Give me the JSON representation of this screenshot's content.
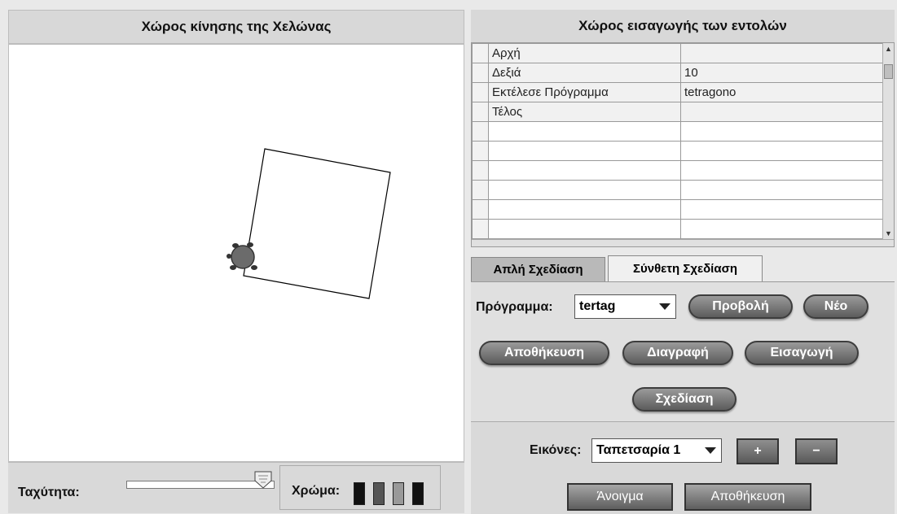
{
  "left_panel": {
    "title": "Χώρος κίνησης της Χελώνας"
  },
  "bottom_left": {
    "speed_label": "Ταχύτητα:",
    "color_label": "Χρώμα:"
  },
  "right_panel": {
    "title": "Χώρος εισαγωγής των εντολών"
  },
  "commands_table": {
    "rows": [
      {
        "command": "Αρχή",
        "value": ""
      },
      {
        "command": "Δεξιά",
        "value": "10"
      },
      {
        "command": "Εκτέλεσε Πρόγραμμα",
        "value": "tetragono"
      },
      {
        "command": "Τέλος",
        "value": ""
      }
    ]
  },
  "tabs": {
    "simple": "Απλή Σχεδίαση",
    "complex": "Σύνθετη Σχεδίαση"
  },
  "program": {
    "label": "Πρόγραμμα:",
    "selected": "tertag",
    "buttons": {
      "view": "Προβολή",
      "new": "Νέο",
      "save": "Αποθήκευση",
      "delete": "Διαγραφή",
      "insert": "Εισαγωγή",
      "draw": "Σχεδίαση"
    }
  },
  "images": {
    "label": "Εικόνες:",
    "selected": "Ταπετσαρία 1",
    "plus": "+",
    "minus": "−",
    "open": "Άνοιγμα",
    "save": "Αποθήκευση"
  },
  "colors": {
    "swatches": [
      "#111111",
      "#555555",
      "#888888",
      "#111111"
    ],
    "turtle": "#555555"
  }
}
